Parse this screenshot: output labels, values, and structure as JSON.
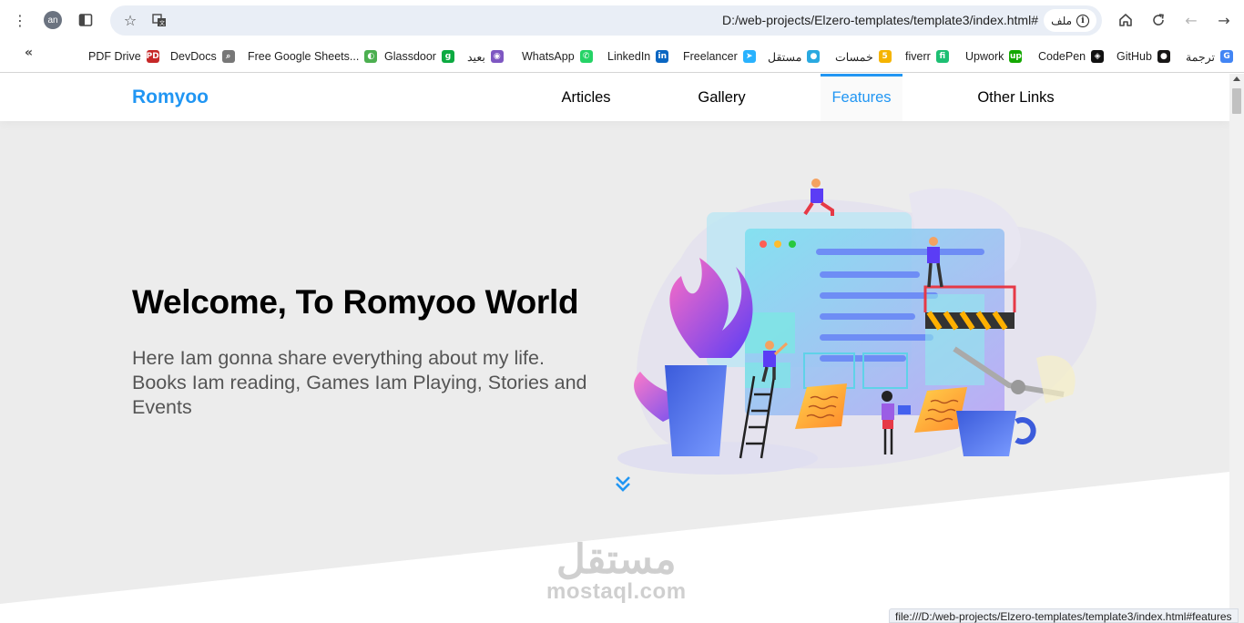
{
  "browser": {
    "avatar_initials": "an",
    "url": "D:/web-projects/Elzero-templates/template3/index.html#",
    "site_chip_label": "ملف",
    "status_url": "file:///D:/web-projects/Elzero-templates/template3/index.html#features",
    "bookmarks": [
      {
        "label": "PDF Drive",
        "icon": "pdfdrive-icon",
        "color": "#c62828",
        "glyph": "PD"
      },
      {
        "label": "DevDocs",
        "icon": "devdocs-icon",
        "color": "#777777",
        "glyph": "⌕"
      },
      {
        "label": "Free Google Sheets...",
        "icon": "sheets-icon",
        "color": "#4caf50",
        "glyph": "◐"
      },
      {
        "label": "Glassdoor",
        "icon": "glassdoor-icon",
        "color": "#0caa41",
        "glyph": "g"
      },
      {
        "label": "بعيد",
        "icon": "baeed-icon",
        "color": "#7e57c2",
        "glyph": "◉"
      },
      {
        "label": "WhatsApp",
        "icon": "whatsapp-icon",
        "color": "#25d366",
        "glyph": "✆"
      },
      {
        "label": "LinkedIn",
        "icon": "linkedin-icon",
        "color": "#0a66c2",
        "glyph": "in"
      },
      {
        "label": "Freelancer",
        "icon": "freelancer-icon",
        "color": "#29b2fe",
        "glyph": "➤"
      },
      {
        "label": "مستقل",
        "icon": "mostaql-icon",
        "color": "#2aa9e0",
        "glyph": "●"
      },
      {
        "label": "خمسات",
        "icon": "khamsat-icon",
        "color": "#f5b400",
        "glyph": "5"
      },
      {
        "label": "fiverr",
        "icon": "fiverr-icon",
        "color": "#1dbf73",
        "glyph": "fi"
      },
      {
        "label": "Upwork",
        "icon": "upwork-icon",
        "color": "#14a800",
        "glyph": "up"
      },
      {
        "label": "CodePen",
        "icon": "codepen-icon",
        "color": "#111111",
        "glyph": "◈"
      },
      {
        "label": "GitHub",
        "icon": "github-icon",
        "color": "#181717",
        "glyph": "●"
      },
      {
        "label": "ترجمة",
        "icon": "translate-icon",
        "color": "#4285f4",
        "glyph": "G"
      }
    ]
  },
  "site": {
    "logo": "Romyoo",
    "nav": [
      "Articles",
      "Gallery",
      "Features",
      "Other Links"
    ],
    "active_nav": "Features",
    "accent_color": "#2196f3",
    "hero_title": "Welcome, To Romyoo World",
    "hero_text": "Here Iam gonna share everything about my life. Books Iam reading, Games Iam Playing, Stories and Events"
  },
  "watermark": {
    "arabic": "مستقل",
    "latin": "mostaql.com"
  }
}
